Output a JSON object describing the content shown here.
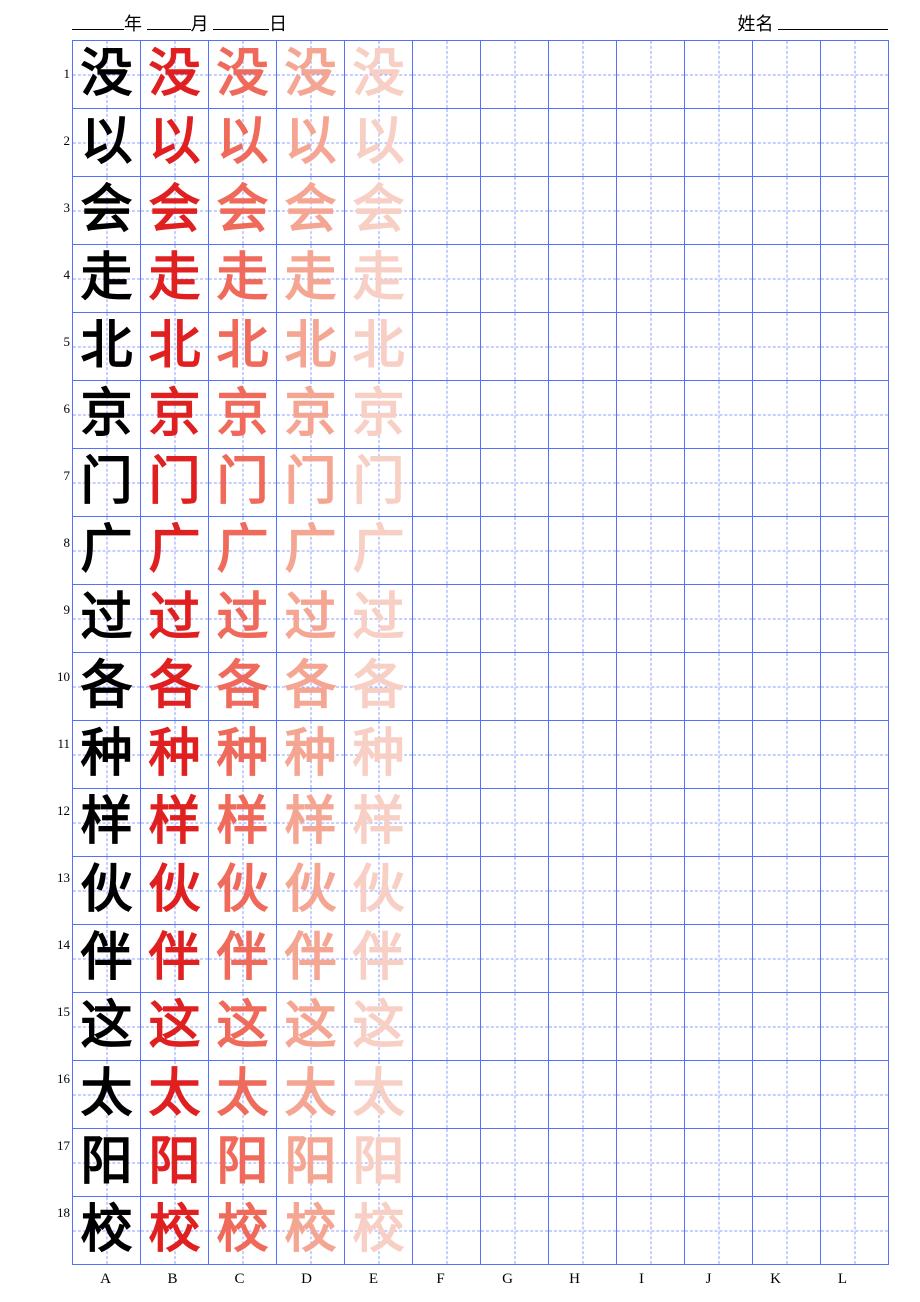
{
  "header": {
    "year_label": "年",
    "month_label": "月",
    "day_label": "日",
    "name_label": "姓名"
  },
  "characters": [
    "没",
    "以",
    "会",
    "走",
    "北",
    "京",
    "门",
    "广",
    "过",
    "各",
    "种",
    "样",
    "伙",
    "伴",
    "这",
    "太",
    "阳",
    "校"
  ],
  "row_labels": [
    "1",
    "2",
    "3",
    "4",
    "5",
    "6",
    "7",
    "8",
    "9",
    "10",
    "11",
    "12",
    "13",
    "14",
    "15",
    "16",
    "17",
    "18"
  ],
  "col_labels": [
    "A",
    "B",
    "C",
    "D",
    "E",
    "F",
    "G",
    "H",
    "I",
    "J",
    "K",
    "L"
  ],
  "trace_colors": [
    "#000000",
    "#e02020",
    "#ef6a5a",
    "#f4a693",
    "#f8cfc4"
  ],
  "columns": 12
}
